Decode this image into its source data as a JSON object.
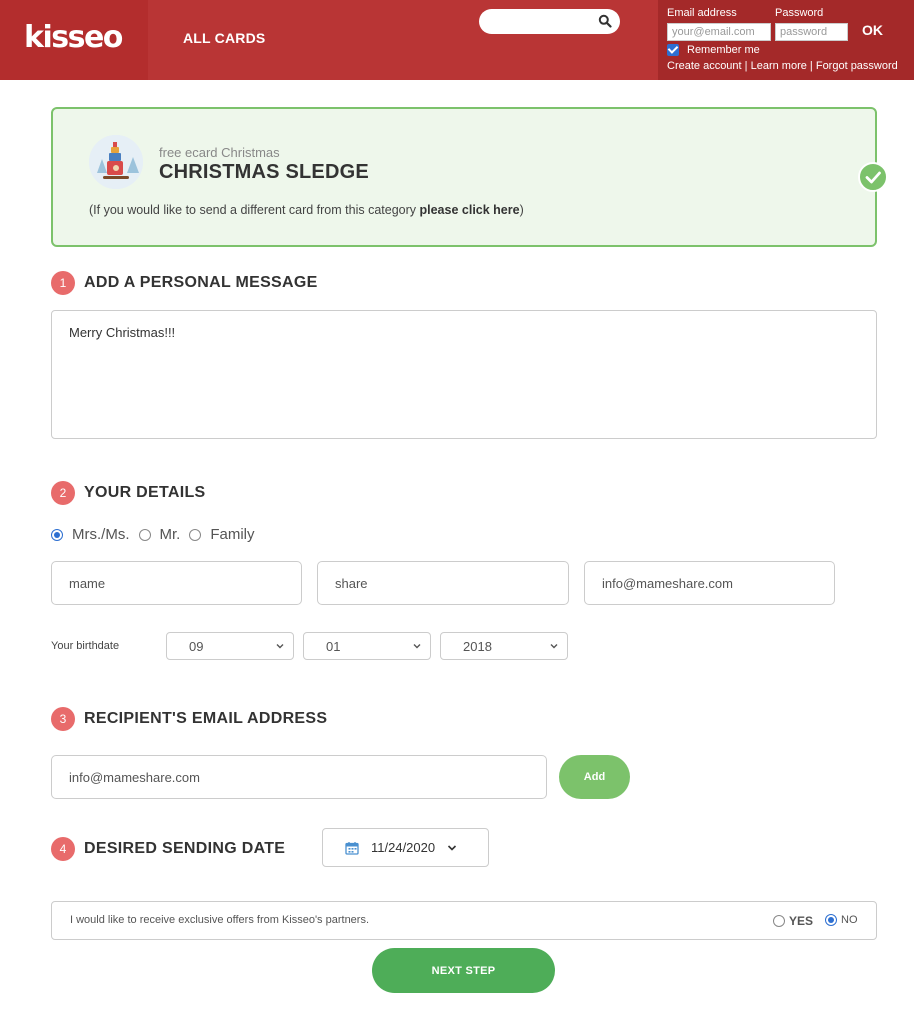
{
  "header": {
    "logo": "kisseo",
    "nav_all_cards": "ALL CARDS",
    "search": {
      "placeholder": ""
    },
    "login": {
      "email_label": "Email address",
      "password_label": "Password",
      "email_placeholder": "your@email.com",
      "password_placeholder": "password",
      "ok_label": "OK",
      "remember_label": "Remember me",
      "remember_checked": true,
      "links": [
        "Create account",
        "Learn more",
        "Forgot password"
      ],
      "link_separator": "|"
    }
  },
  "card": {
    "category": "free ecard Christmas",
    "title": "CHRISTMAS SLEDGE",
    "note_prefix": "(If you would like to send a different card from this category ",
    "note_link": "please click here",
    "note_suffix": ")",
    "selected": true
  },
  "sections": [
    {
      "number": "1",
      "title": "ADD A PERSONAL MESSAGE"
    },
    {
      "number": "2",
      "title": "YOUR DETAILS"
    },
    {
      "number": "3",
      "title": "RECIPIENT'S EMAIL ADDRESS"
    },
    {
      "number": "4",
      "title": "DESIRED SENDING DATE"
    }
  ],
  "message": {
    "value": "Merry Christmas!!!"
  },
  "details": {
    "salutations": [
      {
        "label": "Mrs./Ms.",
        "selected": true
      },
      {
        "label": "Mr.",
        "selected": false
      },
      {
        "label": "Family",
        "selected": false
      }
    ],
    "first_name": "mame",
    "last_name": "share",
    "email": "info@mameshare.com",
    "birthdate_label": "Your birthdate",
    "birth_month": "09",
    "birth_day": "01",
    "birth_year": "2018"
  },
  "recipient": {
    "email": "info@mameshare.com",
    "add_label": "Add"
  },
  "sending_date": {
    "value": "11/24/2020"
  },
  "offers": {
    "text": "I would like to receive exclusive offers from Kisseo's partners.",
    "yes_label": "YES",
    "no_label": "NO",
    "selected": "NO"
  },
  "next_step_label": "NEXT STEP",
  "colors": {
    "header": "#b93535",
    "login_panel": "#a42929",
    "accent_green": "#7cc26b",
    "next_green": "#4ead58",
    "section_badge": "#e86b6b",
    "radio_blue": "#2d6fd1"
  }
}
